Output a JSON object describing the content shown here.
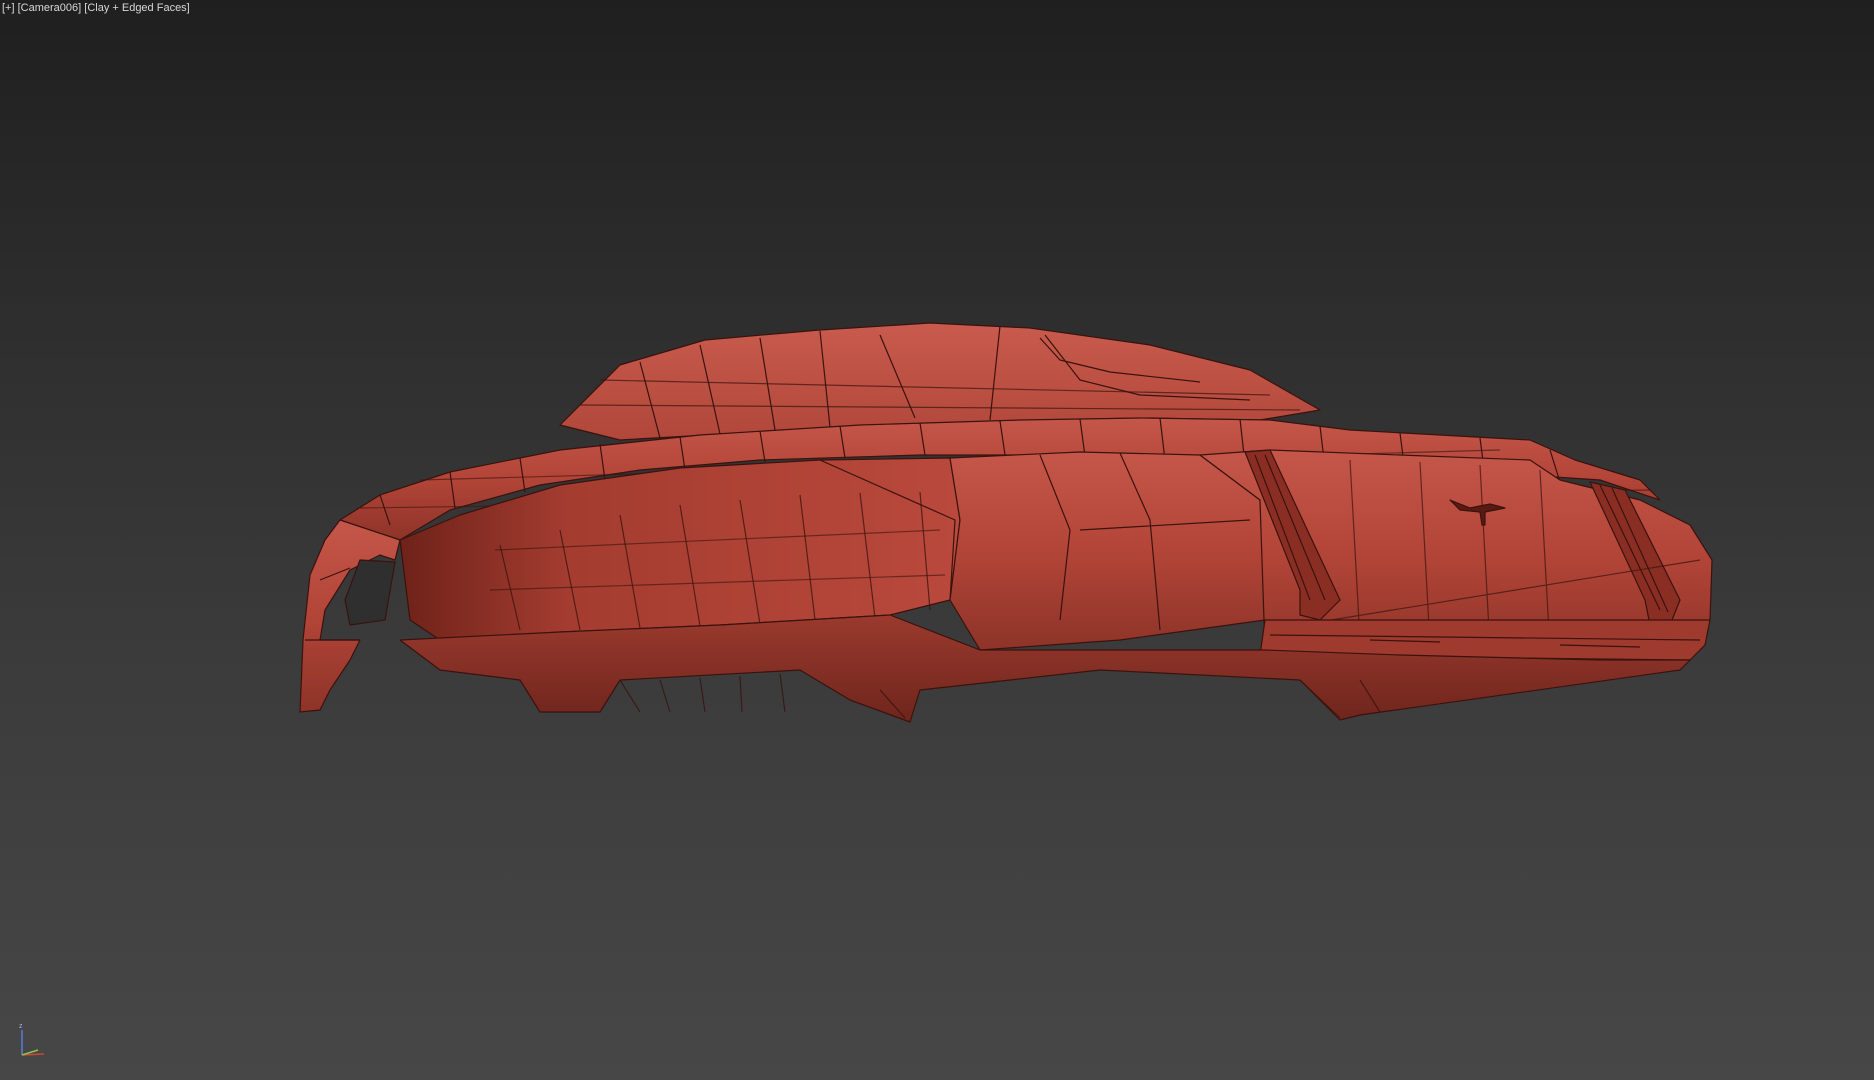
{
  "viewport": {
    "menu_label": "[+]",
    "camera_label": "[Camera006]",
    "shading_label": "[Clay + Edged Faces]"
  },
  "model": {
    "name": "car-body-mesh",
    "color": "#b5483c",
    "edge_color": "#3a120e"
  },
  "gizmo": {
    "z_label": "z",
    "colors": {
      "x": "#c8493a",
      "y": "#8fc24a",
      "z": "#5a7fd6"
    }
  }
}
